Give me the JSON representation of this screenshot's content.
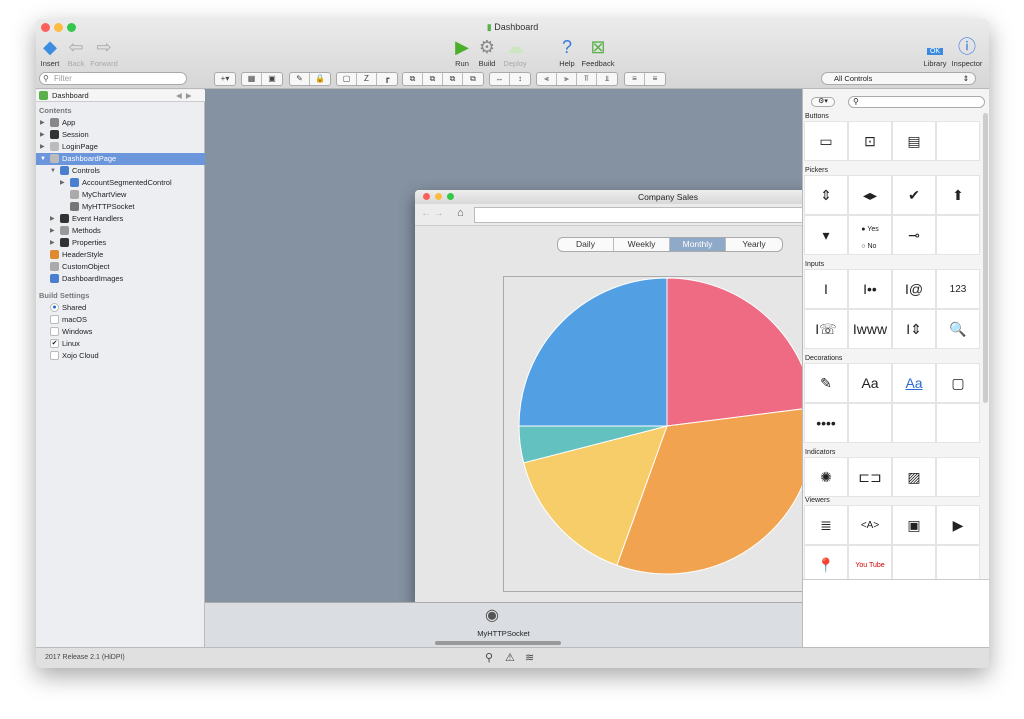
{
  "window": {
    "title": "Dashboard"
  },
  "toolbar": {
    "insert": "Insert",
    "back": "Back",
    "forward": "Forward",
    "run": "Run",
    "build": "Build",
    "deploy": "Deploy",
    "help": "Help",
    "feedback": "Feedback",
    "library": "Library",
    "inspector": "Inspector",
    "library_ok": "OK"
  },
  "navigator": {
    "filter_placeholder": "Filter",
    "project": "Dashboard",
    "contents_header": "Contents",
    "items": [
      {
        "label": "App"
      },
      {
        "label": "Session"
      },
      {
        "label": "LoginPage"
      },
      {
        "label": "DashboardPage"
      },
      {
        "label": "Controls"
      },
      {
        "label": "AccountSegmentedControl"
      },
      {
        "label": "MyChartView"
      },
      {
        "label": "MyHTTPSocket"
      },
      {
        "label": "Event Handlers"
      },
      {
        "label": "Methods"
      },
      {
        "label": "Properties"
      },
      {
        "label": "HeaderStyle"
      },
      {
        "label": "CustomObject"
      },
      {
        "label": "DashboardImages"
      }
    ],
    "build_header": "Build Settings",
    "build": [
      {
        "label": "Shared",
        "state": "radio-on"
      },
      {
        "label": "macOS",
        "state": "off"
      },
      {
        "label": "Windows",
        "state": "off"
      },
      {
        "label": "Linux",
        "state": "checked"
      },
      {
        "label": "Xojo Cloud",
        "state": "off"
      }
    ]
  },
  "webpage": {
    "title": "Company Sales",
    "segments": [
      "Daily",
      "Weekly",
      "Monthly",
      "Yearly"
    ],
    "selected_segment": "Monthly"
  },
  "tray": {
    "label": "MyHTTPSocket"
  },
  "status": {
    "text": "2017 Release 2.1 (HiDPI)"
  },
  "library": {
    "filter": "All Controls",
    "sections": [
      "Buttons",
      "Pickers",
      "Inputs",
      "Decorations",
      "Indicators",
      "Viewers"
    ],
    "radio_yes": "Yes",
    "radio_no": "No",
    "label_aa": "Aa",
    "label_aa_link": "Aa",
    "numeric": "123",
    "html_viewer": "<A>",
    "youtube": "You Tube"
  },
  "chart_data": {
    "type": "pie",
    "values_percent": [
      23,
      32.5,
      15.5,
      4,
      25
    ],
    "colors": [
      "#ef6b83",
      "#f2a34f",
      "#f7cd69",
      "#63c1c0",
      "#529fe4"
    ],
    "start": "top",
    "direction": "clockwise"
  }
}
